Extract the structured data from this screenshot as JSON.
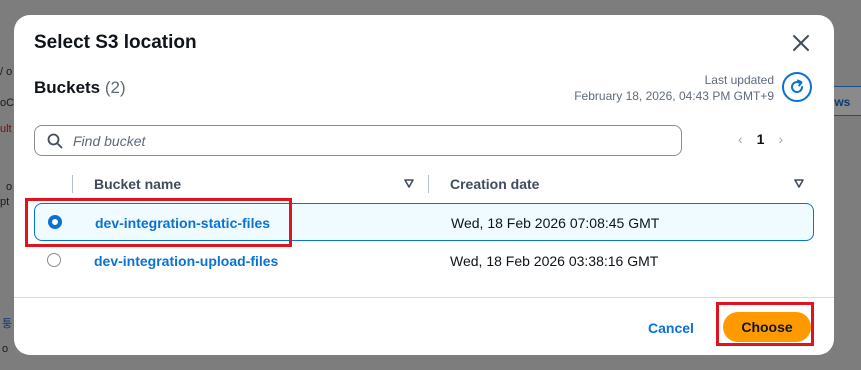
{
  "background": {
    "right_button_label": "ows",
    "fragment_labels": [
      "/ o",
      "oC",
      "ult",
      "o",
      "pt",
      "퉁",
      "o"
    ]
  },
  "modal": {
    "title": "Select S3 location",
    "buckets_label": "Buckets",
    "buckets_count": "(2)",
    "last_updated_label": "Last updated",
    "last_updated_value": "February 18, 2026, 04:43 PM GMT+9",
    "search_placeholder": "Find bucket",
    "pagination": {
      "prev": "‹",
      "page": "1",
      "next": "›"
    },
    "columns": {
      "name": "Bucket name",
      "date": "Creation date"
    },
    "rows": [
      {
        "name": "dev-integration-static-files",
        "date": "Wed, 18 Feb 2026 07:08:45 GMT",
        "selected": true
      },
      {
        "name": "dev-integration-upload-files",
        "date": "Wed, 18 Feb 2026 03:38:16 GMT",
        "selected": false
      }
    ],
    "footer": {
      "cancel": "Cancel",
      "choose": "Choose"
    }
  },
  "colors": {
    "accent": "#0972d3",
    "primary_button": "#ff9900",
    "highlight_box": "#e0141e",
    "selected_row_bg": "#f0fbff"
  }
}
